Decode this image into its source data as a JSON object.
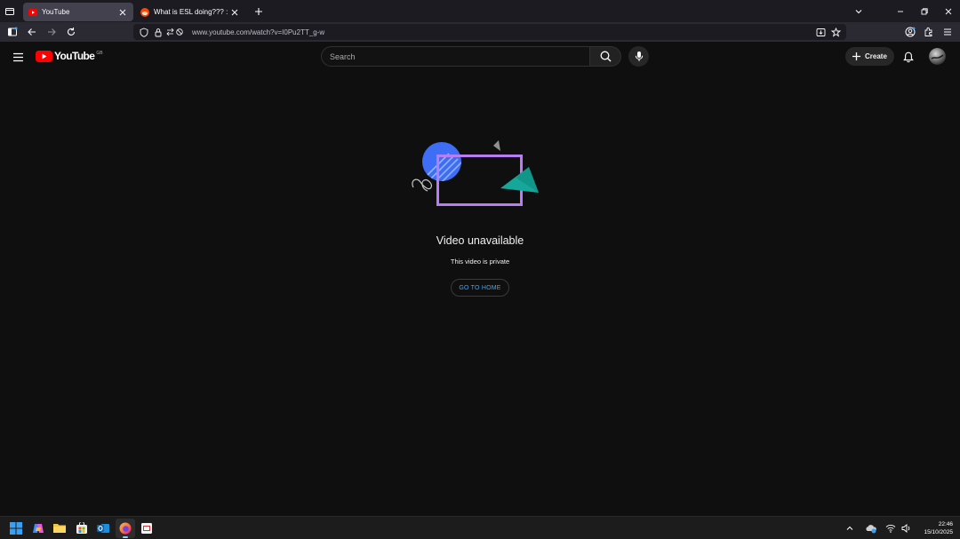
{
  "browser": {
    "tabs": [
      {
        "title": "YouTube",
        "active": true
      },
      {
        "title": "What is ESL doing??? : r/counte",
        "active": false
      }
    ],
    "url": "www.youtube.com/watch?v=I0Pu2TT_g-w"
  },
  "youtube": {
    "logo_text": "YouTube",
    "country_code": "GB",
    "search_placeholder": "Search",
    "create_label": "Create"
  },
  "error": {
    "title": "Video unavailable",
    "subtitle": "This video is private",
    "button_label": "GO TO HOME"
  },
  "taskbar": {
    "time": "22:46",
    "date": "15/10/2025"
  },
  "colors": {
    "background": "#0f0f0f",
    "link_blue": "#3ea6ff",
    "youtube_red": "#ff0000",
    "browser_chrome": "#2b2a33"
  },
  "icons": [
    "tab-list-icon",
    "youtube-favicon",
    "reddit-favicon",
    "close-icon",
    "new-tab-icon",
    "chevron-down-icon",
    "minimize-icon",
    "restore-icon",
    "sidebar-icon",
    "back-icon",
    "forward-icon",
    "reload-icon",
    "shield-icon",
    "lock-icon",
    "permissions-icon",
    "reader-view-icon",
    "bookmark-star-icon",
    "account-icon",
    "extensions-icon",
    "menu-icon",
    "hamburger-icon",
    "search-icon",
    "mic-icon",
    "plus-icon",
    "bell-icon",
    "windows-start-icon",
    "copilot-icon",
    "file-explorer-icon",
    "store-icon",
    "outlook-icon",
    "firefox-icon",
    "app-icon",
    "chevron-up-icon",
    "onedrive-icon",
    "wifi-icon",
    "volume-icon"
  ]
}
